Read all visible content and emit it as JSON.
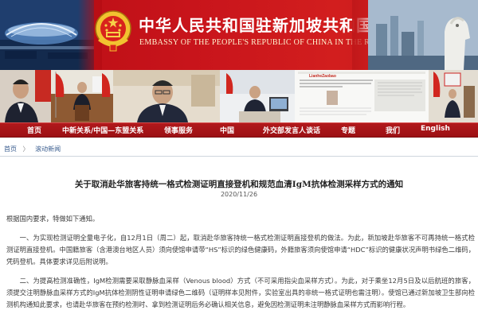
{
  "header": {
    "title_cn": "中华人民共和国驻新加坡共和国大使馆",
    "title_en": "EMBASSY OF THE PEOPLE'S REPUBLIC OF CHINA IN THE REPUBLIC OF SINGAPORE"
  },
  "photos": {
    "newspaper_masthead": "LianheZaobao",
    "newspaper_headline": "Chinese ambassador Sun Haiyan: New journey for China's development new opportunities for China-Singapore cooperation"
  },
  "nav": {
    "items": [
      "首页",
      "中新关系/中国—东盟关系",
      "领事服务",
      "中国",
      "外交部发言人谈话",
      "专题",
      "我们",
      "English"
    ]
  },
  "breadcrumb": {
    "home": "首页",
    "separator": "〉",
    "section": "滚动新闻"
  },
  "article": {
    "title": "关于取消赴华旅客持统一格式检测证明直接登机和规范血清IgM抗体检测采样方式的通知",
    "date": "2020/11/26",
    "paragraphs": [
      "根据国内要求，特做如下通知。",
      "一、为实现检测证明全量电子化，自12月1日（周二）起，取消赴华旅客持统一格式检测证明直接登机的做法。为此，新加坡赴华旅客不可再持统一格式检测证明直接登机。中国籍旅客（含港澳台地区人员）须向使馆申请带“HS”标识的绿色健康码，外籍旅客须向使馆申请“HDC”标识的健康状况声明书绿色二维码，凭码登机。具体要求详见后附说明。",
      "二、为提高检测准确性，IgM检测需要采取静脉血采样（Venous blood）方式（不可采用指尖血采样方式）。为此，对于乘坐12月5日及以后航班的旅客，须提交注明静脉血采样方式的IgM抗体检测阴性证明申请绿色二维码（证明样本见附件，实验室出具的非统一格式证明也需注明）。使馆已通过新加坡卫生部向检测机构通知此要求，也请赴华旅客在预约检测时、拿到检测证明后务必确认相关信息，避免因检测证明未注明静脉血采样方式而影响行程。"
    ]
  },
  "colors": {
    "banner_red": "#c8141b",
    "nav_red": "#a51216",
    "link_blue": "#3a5d8f"
  }
}
